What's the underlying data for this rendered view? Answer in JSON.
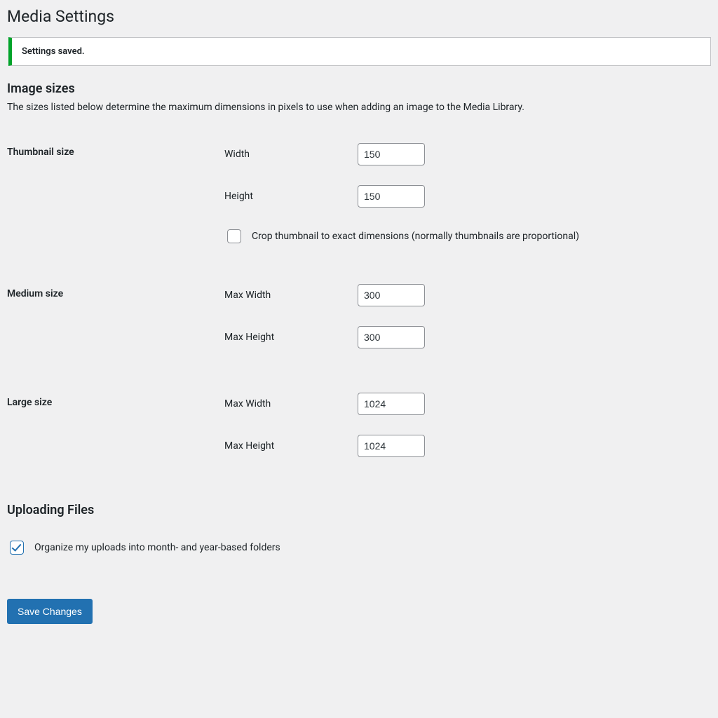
{
  "page": {
    "title": "Media Settings"
  },
  "notice": {
    "message": "Settings saved."
  },
  "image_sizes": {
    "heading": "Image sizes",
    "description": "The sizes listed below determine the maximum dimensions in pixels to use when adding an image to the Media Library.",
    "thumbnail": {
      "label": "Thumbnail size",
      "width_label": "Width",
      "width_value": "150",
      "height_label": "Height",
      "height_value": "150",
      "crop_label": "Crop thumbnail to exact dimensions (normally thumbnails are proportional)",
      "crop_checked": false
    },
    "medium": {
      "label": "Medium size",
      "width_label": "Max Width",
      "width_value": "300",
      "height_label": "Max Height",
      "height_value": "300"
    },
    "large": {
      "label": "Large size",
      "width_label": "Max Width",
      "width_value": "1024",
      "height_label": "Max Height",
      "height_value": "1024"
    }
  },
  "uploading": {
    "heading": "Uploading Files",
    "organize_label": "Organize my uploads into month- and year-based folders",
    "organize_checked": true
  },
  "actions": {
    "save_label": "Save Changes"
  }
}
